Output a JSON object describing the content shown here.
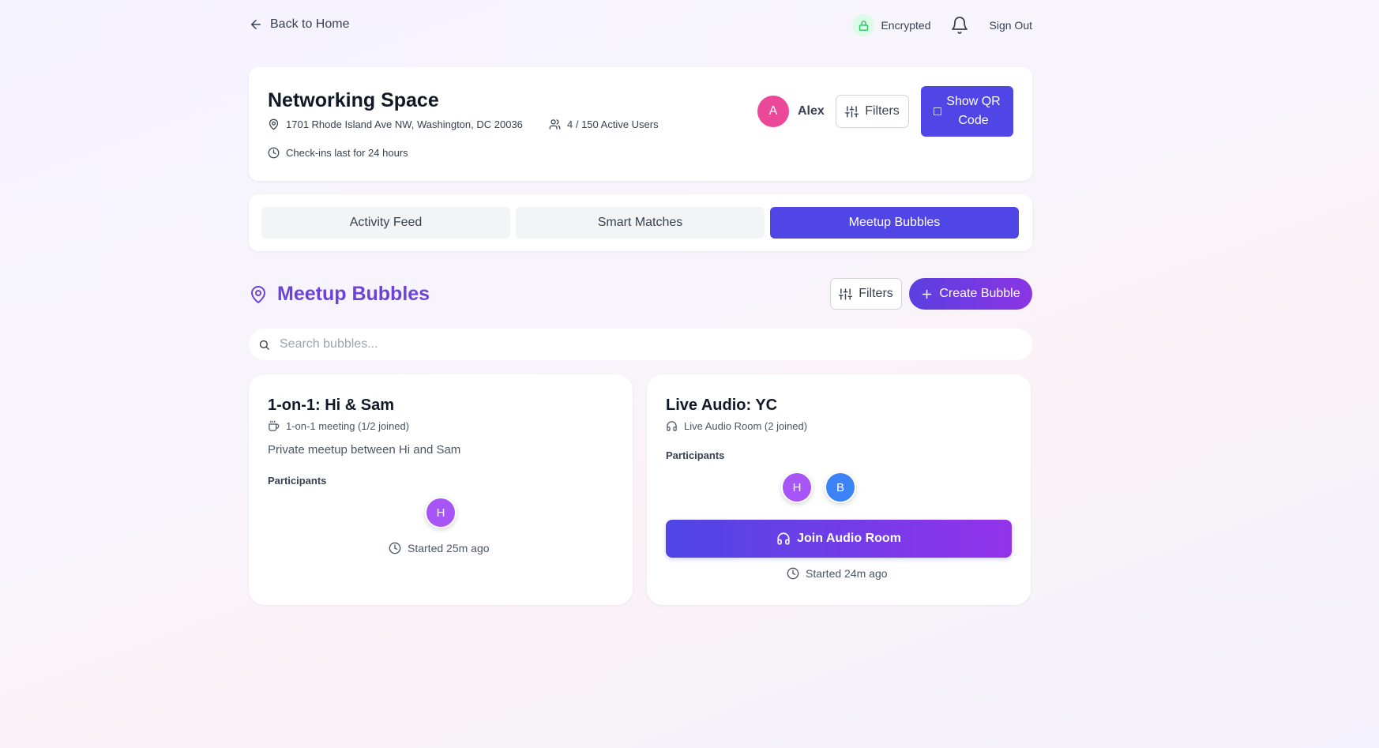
{
  "topbar": {
    "back_label": "Back to Home",
    "encrypted_label": "Encrypted",
    "sign_out_label": "Sign Out"
  },
  "space": {
    "title": "Networking Space",
    "address": "1701 Rhode Island Ave NW, Washington, DC 20036",
    "active_users": "4 / 150 Active Users",
    "checkin_note": "Check-ins last for 24 hours",
    "user_initial": "A",
    "user_name": "Alex",
    "filters_label": "Filters",
    "qr_label": "Show QR Code"
  },
  "tabs": [
    {
      "label": "Activity Feed",
      "active": false
    },
    {
      "label": "Smart Matches",
      "active": false
    },
    {
      "label": "Meetup Bubbles",
      "active": true
    }
  ],
  "section": {
    "title": "Meetup Bubbles",
    "filters_label": "Filters",
    "create_label": "Create Bubble"
  },
  "search": {
    "placeholder": "Search bubbles...",
    "value": ""
  },
  "bubbles": [
    {
      "title": "1-on-1: Hi & Sam",
      "type_icon": "coffee-icon",
      "subtitle": "1-on-1 meeting (1/2 joined)",
      "description": "Private meetup between Hi and Sam",
      "participants_label": "Participants",
      "participants": [
        "H"
      ],
      "started": "Started 25m ago"
    },
    {
      "title": "Live Audio: YC",
      "type_icon": "headphones-icon",
      "subtitle": "Live Audio Room (2 joined)",
      "participants_label": "Participants",
      "participants": [
        "H",
        "B"
      ],
      "join_label": "Join Audio Room",
      "started": "Started 24m ago"
    }
  ],
  "colors": {
    "primary": "#4f46e5",
    "accent_purple": "#9333ea",
    "section_title": "#6d42d9",
    "avatar_pink": "#ec4899",
    "avatar_purple": "#a855f7",
    "avatar_blue": "#3b82f6",
    "encrypted_green": "#22c55e"
  }
}
